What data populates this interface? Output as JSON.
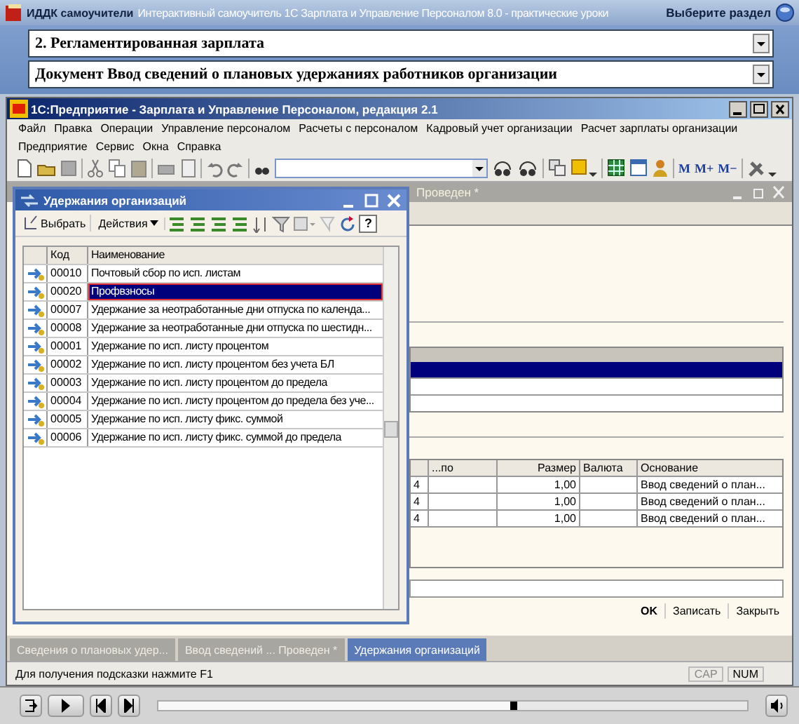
{
  "app_bar": {
    "brand": "ИДДК самоучители",
    "title": "Интерактивный самоучитель 1С Зарплата и Управление Персоналом 8.0 - практические уроки",
    "section_button": "Выберите раздел"
  },
  "selectors": [
    {
      "value": "2. Регламентированная зарплата"
    },
    {
      "value": "Документ Ввод сведений о плановых удержаниях работников организации"
    }
  ],
  "window": {
    "title": "1С:Предприятие - Зарплата и Управление Персоналом, редакция 2.1"
  },
  "menu": [
    [
      {
        "label": "Файл"
      },
      {
        "label": "Правка"
      },
      {
        "label": "Операции"
      },
      {
        "label": "Управление персоналом"
      },
      {
        "label": "Расчеты с персоналом"
      },
      {
        "label": "Кадровый учет организации"
      },
      {
        "label": "Расчет зарплаты организации"
      }
    ],
    [
      {
        "label": "Предприятие"
      },
      {
        "label": "Сервис"
      },
      {
        "label": "Окна"
      },
      {
        "label": "Справка"
      }
    ]
  ],
  "toolbar": {
    "memory_buttons": [
      "M",
      "M+",
      "M−"
    ]
  },
  "document_window": {
    "title": "Проведен *",
    "table": {
      "columns": [
        "...по",
        "Размер",
        "Валюта",
        "Основание"
      ],
      "rows": [
        {
          "cells": [
            "4",
            "",
            "1,00",
            "",
            "Ввод сведений о план..."
          ]
        },
        {
          "cells": [
            "4",
            "",
            "1,00",
            "",
            "Ввод сведений о план..."
          ]
        },
        {
          "cells": [
            "4",
            "",
            "1,00",
            "",
            "Ввод сведений о план..."
          ]
        }
      ]
    },
    "buttons": [
      {
        "label": "OK",
        "default": true
      },
      {
        "label": "Записать",
        "default": false
      },
      {
        "label": "Закрыть",
        "default": false
      }
    ]
  },
  "list_window": {
    "title": "Удержания организаций",
    "select_button": "Выбрать",
    "actions_button": "Действия",
    "help_button": "?",
    "columns": [
      "Код",
      "Наименование"
    ],
    "rows": [
      {
        "code": "00010",
        "name": "Почтовый сбор по исп. листам",
        "selected": false
      },
      {
        "code": "00020",
        "name": "Профвзносы",
        "selected": true
      },
      {
        "code": "00007",
        "name": "Удержание за неотработанные дни отпуска по календа...",
        "selected": false
      },
      {
        "code": "00008",
        "name": "Удержание за неотработанные дни отпуска по шестидн...",
        "selected": false
      },
      {
        "code": "00001",
        "name": "Удержание по исп. листу процентом",
        "selected": false
      },
      {
        "code": "00002",
        "name": "Удержание по исп. листу процентом без учета БЛ",
        "selected": false
      },
      {
        "code": "00003",
        "name": "Удержание по исп. листу процентом до предела",
        "selected": false
      },
      {
        "code": "00004",
        "name": "Удержание по исп. листу процентом до предела без уче...",
        "selected": false
      },
      {
        "code": "00005",
        "name": "Удержание по исп. листу фикс. суммой",
        "selected": false
      },
      {
        "code": "00006",
        "name": "Удержание по исп. листу фикс. суммой до предела",
        "selected": false
      }
    ]
  },
  "taskbar": [
    {
      "label": "Сведения о плановых удер...",
      "selected": false
    },
    {
      "label": "Ввод сведений ... Проведен *",
      "selected": false
    },
    {
      "label": "Удержания организаций",
      "selected": true
    }
  ],
  "status_bar": {
    "hint": "Для получения подсказки нажмите F1",
    "indicators": [
      "CAP",
      "NUM"
    ]
  },
  "player": {
    "level": 0.61
  }
}
